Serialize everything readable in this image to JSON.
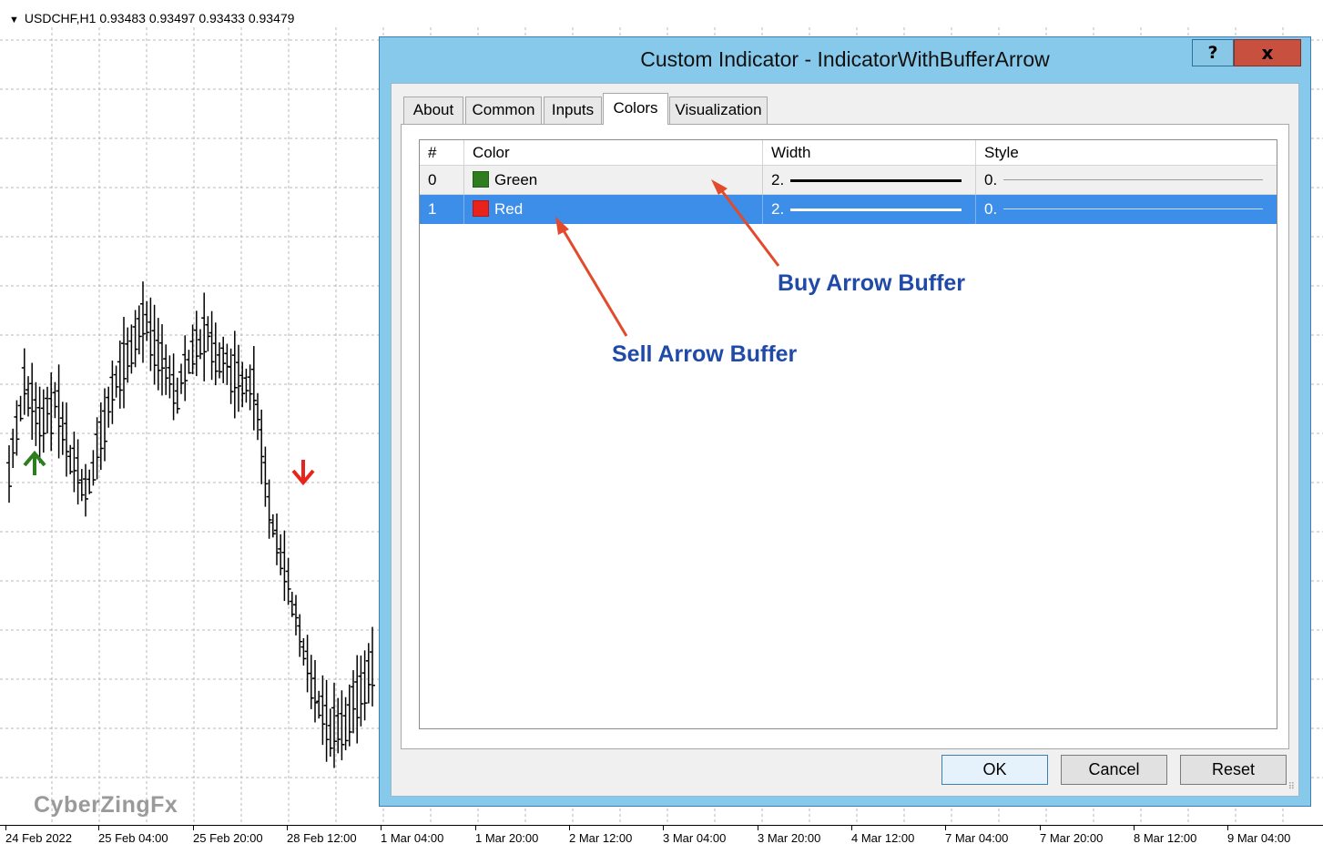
{
  "chart": {
    "symbol_line": "USDCHF,H1  0.93483 0.93497 0.93433 0.93479",
    "watermark": "CyberZingFx",
    "time_labels": [
      "24 Feb 2022",
      "25 Feb 04:00",
      "25 Feb 20:00",
      "28 Feb 12:00",
      "1 Mar 04:00",
      "1 Mar 20:00",
      "2 Mar 12:00",
      "3 Mar 04:00",
      "3 Mar 20:00",
      "4 Mar 12:00",
      "7 Mar 04:00",
      "7 Mar 20:00",
      "8 Mar 12:00",
      "9 Mar 04:00"
    ],
    "buy_arrow_color": "#2e7d1e",
    "sell_arrow_color": "#e8231c"
  },
  "dialog": {
    "title": "Custom Indicator - IndicatorWithBufferArrow",
    "help_label": "?",
    "close_label": "x",
    "tabs": [
      {
        "label": "About",
        "active": false
      },
      {
        "label": "Common",
        "active": false
      },
      {
        "label": "Inputs",
        "active": false
      },
      {
        "label": "Colors",
        "active": true
      },
      {
        "label": "Visualization",
        "active": false
      }
    ],
    "grid": {
      "headers": [
        "#",
        "Color",
        "Width",
        "Style"
      ],
      "rows": [
        {
          "index": "0",
          "color_name": "Green",
          "color_hex": "#2e7d1e",
          "width": "2.",
          "style": "0.",
          "selected": false
        },
        {
          "index": "1",
          "color_name": "Red",
          "color_hex": "#e8231c",
          "width": "2.",
          "style": "0.",
          "selected": true
        }
      ]
    },
    "annotations": {
      "buy": "Buy Arrow Buffer",
      "sell": "Sell Arrow Buffer",
      "arrow_color": "#e24a2b"
    },
    "buttons": {
      "ok": "OK",
      "cancel": "Cancel",
      "reset": "Reset"
    }
  }
}
